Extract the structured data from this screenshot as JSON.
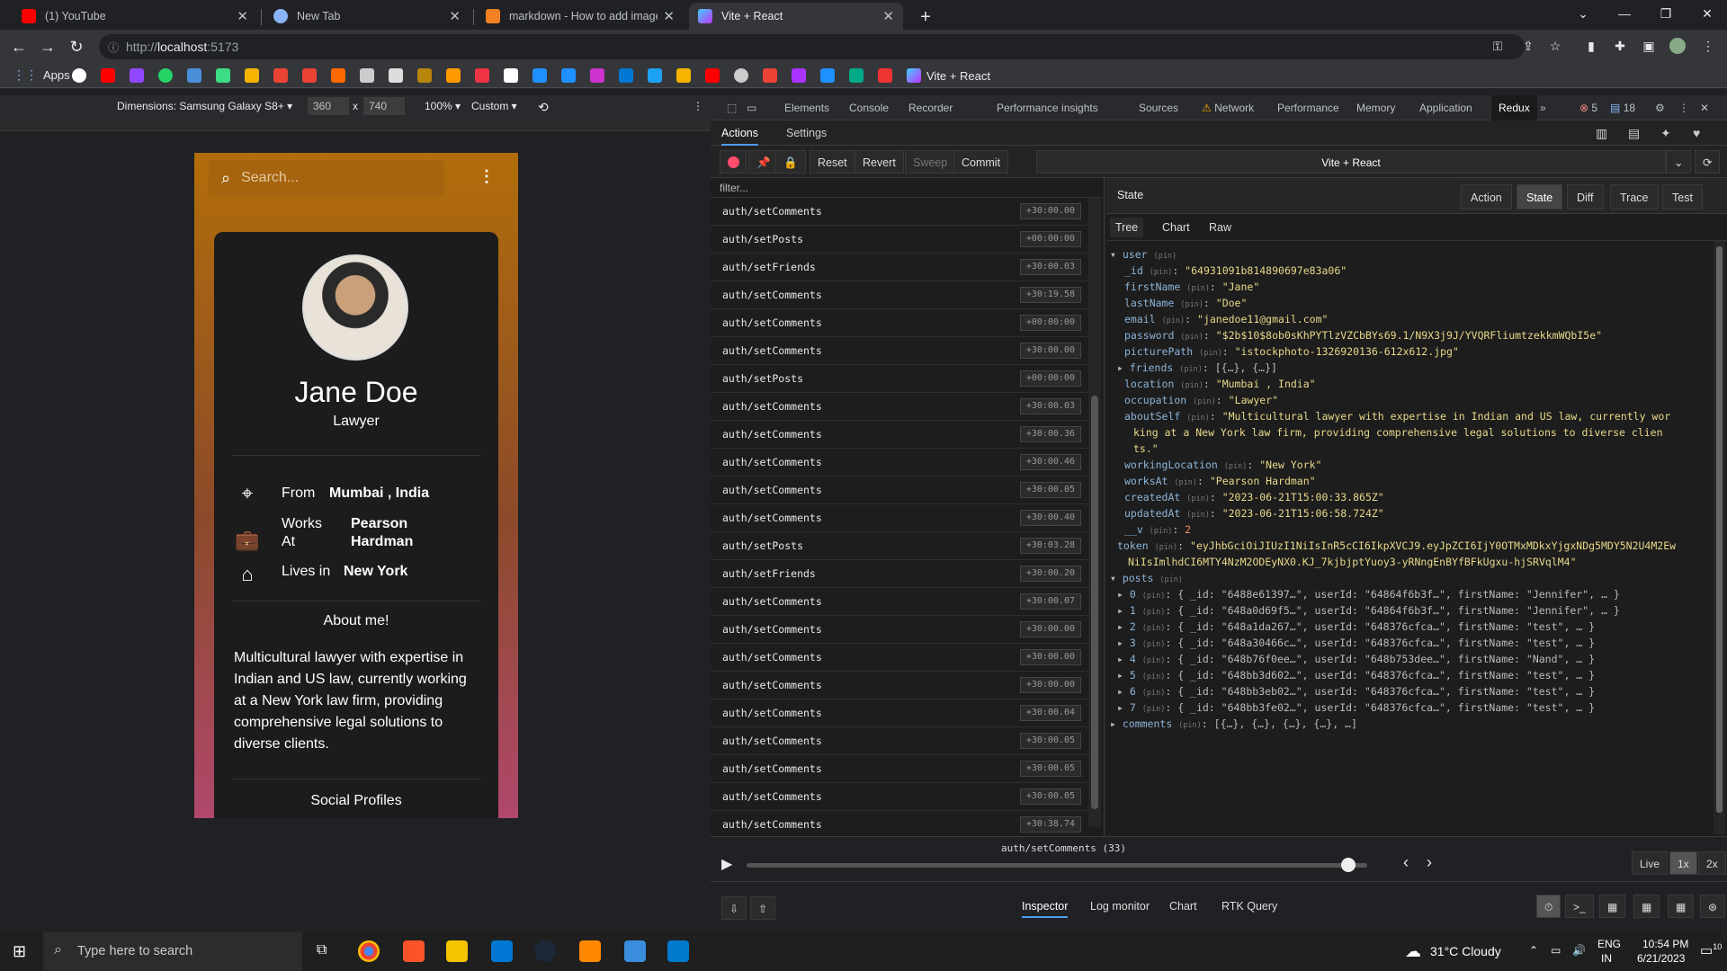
{
  "browser": {
    "tabs": [
      {
        "title": "(1) YouTube",
        "favicon_color": "#ff0000",
        "active": false
      },
      {
        "title": "New Tab",
        "favicon_color": "#8ab4f8",
        "active": false
      },
      {
        "title": "markdown - How to add images",
        "favicon_color": "#f48024",
        "active": false
      },
      {
        "title": "Vite + React",
        "favicon_color": "#bd34fe",
        "active": true
      }
    ],
    "url_scheme": "http://",
    "url_host": "localhost",
    "url_port": ":5173",
    "bookmarks_apps": "Apps",
    "bookmark_last": "Vite + React"
  },
  "device_toolbar": {
    "dimensions_label": "Dimensions: Samsung Galaxy S8+",
    "width": "360",
    "height": "740",
    "times": "x",
    "zoom": "100%",
    "throttle": "Custom"
  },
  "app": {
    "search_placeholder": "Search...",
    "user": {
      "name": "Jane Doe",
      "occupation": "Lawyer",
      "from_label": "From",
      "from_value": "Mumbai , India",
      "works_label_1": "Works",
      "works_label_2": "At",
      "works_value_1": "Pearson",
      "works_value_2": "Hardman",
      "lives_label": "Lives in",
      "lives_value": "New York",
      "about_heading": "About me!",
      "about_text": "Multicultural lawyer with expertise in Indian and US law, currently working at a New York law firm, providing comprehensive legal solutions to diverse clients.",
      "social_heading": "Social Profiles"
    }
  },
  "devtools": {
    "tabs": [
      "Elements",
      "Console",
      "Recorder",
      "Performance insights",
      "Sources",
      "Network",
      "Performance",
      "Memory",
      "Application",
      "Redux"
    ],
    "active_tab": "Redux",
    "error_count": "5",
    "message_count": "18",
    "redux": {
      "subtabs": [
        "Actions",
        "Settings"
      ],
      "buttons": [
        "Reset",
        "Revert",
        "Sweep",
        "Commit"
      ],
      "instance": "Vite + React",
      "filter_placeholder": "filter...",
      "actions": [
        {
          "type": "auth/setComments",
          "time": "+30:00.00"
        },
        {
          "type": "auth/setPosts",
          "time": "+00:00:00"
        },
        {
          "type": "auth/setFriends",
          "time": "+30:00.03"
        },
        {
          "type": "auth/setComments",
          "time": "+30:19.58"
        },
        {
          "type": "auth/setComments",
          "time": "+00:00:00"
        },
        {
          "type": "auth/setComments",
          "time": "+30:00.00"
        },
        {
          "type": "auth/setPosts",
          "time": "+00:00:00"
        },
        {
          "type": "auth/setComments",
          "time": "+30:00.03"
        },
        {
          "type": "auth/setComments",
          "time": "+30:00.36"
        },
        {
          "type": "auth/setComments",
          "time": "+30:00.46"
        },
        {
          "type": "auth/setComments",
          "time": "+30:00.05"
        },
        {
          "type": "auth/setComments",
          "time": "+30:00.40"
        },
        {
          "type": "auth/setPosts",
          "time": "+30:03.28"
        },
        {
          "type": "auth/setFriends",
          "time": "+30:00.20"
        },
        {
          "type": "auth/setComments",
          "time": "+30:00.07"
        },
        {
          "type": "auth/setComments",
          "time": "+30:00.00"
        },
        {
          "type": "auth/setComments",
          "time": "+30:00.00"
        },
        {
          "type": "auth/setComments",
          "time": "+30:00.00"
        },
        {
          "type": "auth/setComments",
          "time": "+30:00.04"
        },
        {
          "type": "auth/setComments",
          "time": "+30:00.05"
        },
        {
          "type": "auth/setComments",
          "time": "+30:00.05"
        },
        {
          "type": "auth/setComments",
          "time": "+30:00.05"
        },
        {
          "type": "auth/setComments",
          "time": "+30:38.74"
        }
      ],
      "state_title": "State",
      "monitor_buttons": [
        "Action",
        "State",
        "Diff",
        "Trace",
        "Test"
      ],
      "active_monitor": "State",
      "view_tabs": [
        "Tree",
        "Chart",
        "Raw"
      ],
      "active_view": "Tree",
      "pin": "(pin)",
      "tree": {
        "user_key": "user",
        "fields": [
          {
            "k": "_id",
            "v": "\"64931091b814890697e83a06\"",
            "kind": "s"
          },
          {
            "k": "firstName",
            "v": "\"Jane\"",
            "kind": "s"
          },
          {
            "k": "lastName",
            "v": "\"Doe\"",
            "kind": "s"
          },
          {
            "k": "email",
            "v": "\"janedoe11@gmail.com\"",
            "kind": "s"
          },
          {
            "k": "password",
            "v": "\"$2b$10$8ob0sKhPYTlzVZCbBYs69.1/N9X3j9J/YVQRFliumtzekkmWQbI5e\"",
            "kind": "s"
          },
          {
            "k": "picturePath",
            "v": "\"istockphoto-1326920136-612x612.jpg\"",
            "kind": "s"
          },
          {
            "k": "friends",
            "v": "[{…}, {…}]",
            "kind": "c",
            "arrow": true
          },
          {
            "k": "location",
            "v": "\"Mumbai , India\"",
            "kind": "s"
          },
          {
            "k": "occupation",
            "v": "\"Lawyer\"",
            "kind": "s"
          },
          {
            "k": "aboutSelf",
            "v": "\"Multicultural lawyer with expertise in Indian and US law, currently wor",
            "kind": "s"
          },
          {
            "k": "",
            "v": "king at a New York law firm, providing comprehensive legal solutions to diverse clien",
            "kind": "s",
            "cont": true
          },
          {
            "k": "",
            "v": "ts.\"",
            "kind": "s",
            "cont": true
          },
          {
            "k": "workingLocation",
            "v": "\"New York\"",
            "kind": "s"
          },
          {
            "k": "worksAt",
            "v": "\"Pearson Hardman\"",
            "kind": "s"
          },
          {
            "k": "createdAt",
            "v": "\"2023-06-21T15:00:33.865Z\"",
            "kind": "s"
          },
          {
            "k": "updatedAt",
            "v": "\"2023-06-21T15:06:58.724Z\"",
            "kind": "s"
          },
          {
            "k": "__v",
            "v": "2",
            "kind": "n"
          }
        ],
        "token_key": "token",
        "token_1": "\"eyJhbGciOiJIUzI1NiIsInR5cCI6IkpXVCJ9.eyJpZCI6IjY0OTMxMDkxYjgxNDg5MDY5N2U4M2Ew",
        "token_2": "NiIsImlhdCI6MTY4NzM2ODEyNX0.KJ_7kjbjptYuoy3-yRNngEnBYfBFkUgxu-hjSRVqlM4\"",
        "posts_key": "posts",
        "posts": [
          {
            "i": "0",
            "v": "{ _id: \"6488e61397…\", userId: \"64864f6b3f…\", firstName: \"Jennifer\", … }"
          },
          {
            "i": "1",
            "v": "{ _id: \"648a0d69f5…\", userId: \"64864f6b3f…\", firstName: \"Jennifer\", … }"
          },
          {
            "i": "2",
            "v": "{ _id: \"648a1da267…\", userId: \"648376cfca…\", firstName: \"test\", … }"
          },
          {
            "i": "3",
            "v": "{ _id: \"648a30466c…\", userId: \"648376cfca…\", firstName: \"test\", … }"
          },
          {
            "i": "4",
            "v": "{ _id: \"648b76f0ee…\", userId: \"648b753dee…\", firstName: \"Nand\", … }"
          },
          {
            "i": "5",
            "v": "{ _id: \"648bb3d602…\", userId: \"648376cfca…\", firstName: \"test\", … }"
          },
          {
            "i": "6",
            "v": "{ _id: \"648bb3eb02…\", userId: \"648376cfca…\", firstName: \"test\", … }"
          },
          {
            "i": "7",
            "v": "{ _id: \"648bb3fe02…\", userId: \"648376cfca…\", firstName: \"test\", … }"
          }
        ],
        "comments_key": "comments",
        "comments_value": "[{…}, {…}, {…}, {…}, …]"
      },
      "slider_label": "auth/setComments",
      "slider_count": "(33)",
      "slider_position": 0.97,
      "live": "Live",
      "speeds": [
        "1x",
        "2x"
      ],
      "active_speed": "1x",
      "monitors": [
        "Inspector",
        "Log monitor",
        "Chart",
        "RTK Query"
      ],
      "active_monitor_bottom": "Inspector"
    }
  },
  "taskbar": {
    "search_placeholder": "Type here to search",
    "weather": "31°C  Cloudy",
    "lang_1": "ENG",
    "lang_2": "IN",
    "time": "10:54 PM",
    "date": "6/21/2023",
    "notif": "10"
  }
}
